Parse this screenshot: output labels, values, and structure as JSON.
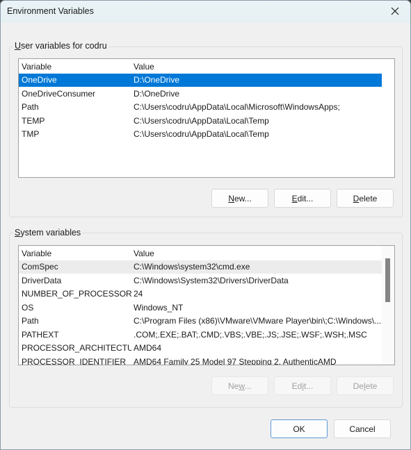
{
  "window": {
    "title": "Environment Variables",
    "close_icon": "close-icon"
  },
  "user_vars": {
    "group_label_prefix": "U",
    "group_label_rest": "ser variables for codru",
    "columns": [
      "Variable",
      "Value"
    ],
    "rows": [
      {
        "variable": "OneDrive",
        "value": "D:\\OneDrive",
        "selected": true
      },
      {
        "variable": "OneDriveConsumer",
        "value": "D:\\OneDrive"
      },
      {
        "variable": "Path",
        "value": "C:\\Users\\codru\\AppData\\Local\\Microsoft\\WindowsApps;"
      },
      {
        "variable": "TEMP",
        "value": "C:\\Users\\codru\\AppData\\Local\\Temp"
      },
      {
        "variable": "TMP",
        "value": "C:\\Users\\codru\\AppData\\Local\\Temp"
      }
    ],
    "buttons": {
      "new": {
        "mn": "N",
        "rest": "ew..."
      },
      "edit": {
        "mn": "E",
        "rest": "dit..."
      },
      "delete": {
        "mn": "D",
        "rest": "elete"
      }
    }
  },
  "system_vars": {
    "group_label_prefix": "S",
    "group_label_rest": "ystem variables",
    "columns": [
      "Variable",
      "Value"
    ],
    "rows": [
      {
        "variable": "ComSpec",
        "value": "C:\\Windows\\system32\\cmd.exe",
        "hover": true
      },
      {
        "variable": "DriverData",
        "value": "C:\\Windows\\System32\\Drivers\\DriverData"
      },
      {
        "variable": "NUMBER_OF_PROCESSORS",
        "value": "24"
      },
      {
        "variable": "OS",
        "value": "Windows_NT"
      },
      {
        "variable": "Path",
        "value": "C:\\Program Files (x86)\\VMware\\VMware Player\\bin\\;C:\\Windows\\..."
      },
      {
        "variable": "PATHEXT",
        "value": ".COM;.EXE;.BAT;.CMD;.VBS;.VBE;.JS;.JSE;.WSF;.WSH;.MSC"
      },
      {
        "variable": "PROCESSOR_ARCHITECTURE",
        "value": "AMD64"
      },
      {
        "variable": "PROCESSOR_IDENTIFIER",
        "value": "AMD64 Family 25 Model 97 Stepping 2, AuthenticAMD"
      }
    ],
    "buttons": {
      "new": {
        "a": "Ne",
        "mn": "w",
        "b": "..."
      },
      "edit": {
        "a": "Ed",
        "mn": "i",
        "b": "t..."
      },
      "delete": {
        "a": "De",
        "mn": "l",
        "b": "ete"
      }
    },
    "buttons_disabled": true
  },
  "footer": {
    "ok": "OK",
    "cancel": "Cancel"
  },
  "colors": {
    "selection": "#0078d7",
    "dialog_bg": "#f0f0f0",
    "default_button_border": "#5b9bd5"
  }
}
